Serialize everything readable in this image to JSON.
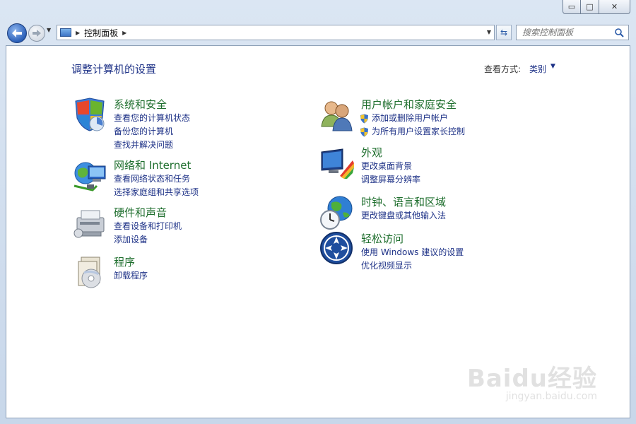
{
  "window": {
    "caption_buttons": {
      "minimize": "▭",
      "maximize": "□",
      "close": "✕"
    }
  },
  "navbar": {
    "address_path": "控制面板",
    "search_placeholder": "搜索控制面板"
  },
  "page": {
    "title": "调整计算机的设置",
    "view_by_label": "查看方式:",
    "view_by_value": "类别"
  },
  "categories_left": [
    {
      "title": "系统和安全",
      "icon": "system-security-icon",
      "links": [
        {
          "label": "查看您的计算机状态"
        },
        {
          "label": "备份您的计算机"
        },
        {
          "label": "查找并解决问题"
        }
      ]
    },
    {
      "title": "网络和 Internet",
      "icon": "network-internet-icon",
      "links": [
        {
          "label": "查看网络状态和任务"
        },
        {
          "label": "选择家庭组和共享选项"
        }
      ]
    },
    {
      "title": "硬件和声音",
      "icon": "hardware-sound-icon",
      "links": [
        {
          "label": "查看设备和打印机"
        },
        {
          "label": "添加设备"
        }
      ]
    },
    {
      "title": "程序",
      "icon": "programs-icon",
      "links": [
        {
          "label": "卸载程序"
        }
      ]
    }
  ],
  "categories_right": [
    {
      "title": "用户帐户和家庭安全",
      "icon": "user-accounts-icon",
      "links": [
        {
          "label": "添加或删除用户帐户",
          "shield": true
        },
        {
          "label": "为所有用户设置家长控制",
          "shield": true
        }
      ]
    },
    {
      "title": "外观",
      "icon": "appearance-icon",
      "links": [
        {
          "label": "更改桌面背景"
        },
        {
          "label": "调整屏幕分辨率"
        }
      ]
    },
    {
      "title": "时钟、语言和区域",
      "icon": "clock-region-icon",
      "links": [
        {
          "label": "更改键盘或其他输入法"
        }
      ]
    },
    {
      "title": "轻松访问",
      "icon": "ease-of-access-icon",
      "links": [
        {
          "label": "使用 Windows 建议的设置"
        },
        {
          "label": "优化视频显示"
        }
      ]
    }
  ],
  "watermark": {
    "logo": "Baidu经验",
    "url": "jingyan.baidu.com"
  },
  "colors": {
    "link": "#1e3287",
    "category_title": "#1e6e2d",
    "title": "#1e3287"
  }
}
